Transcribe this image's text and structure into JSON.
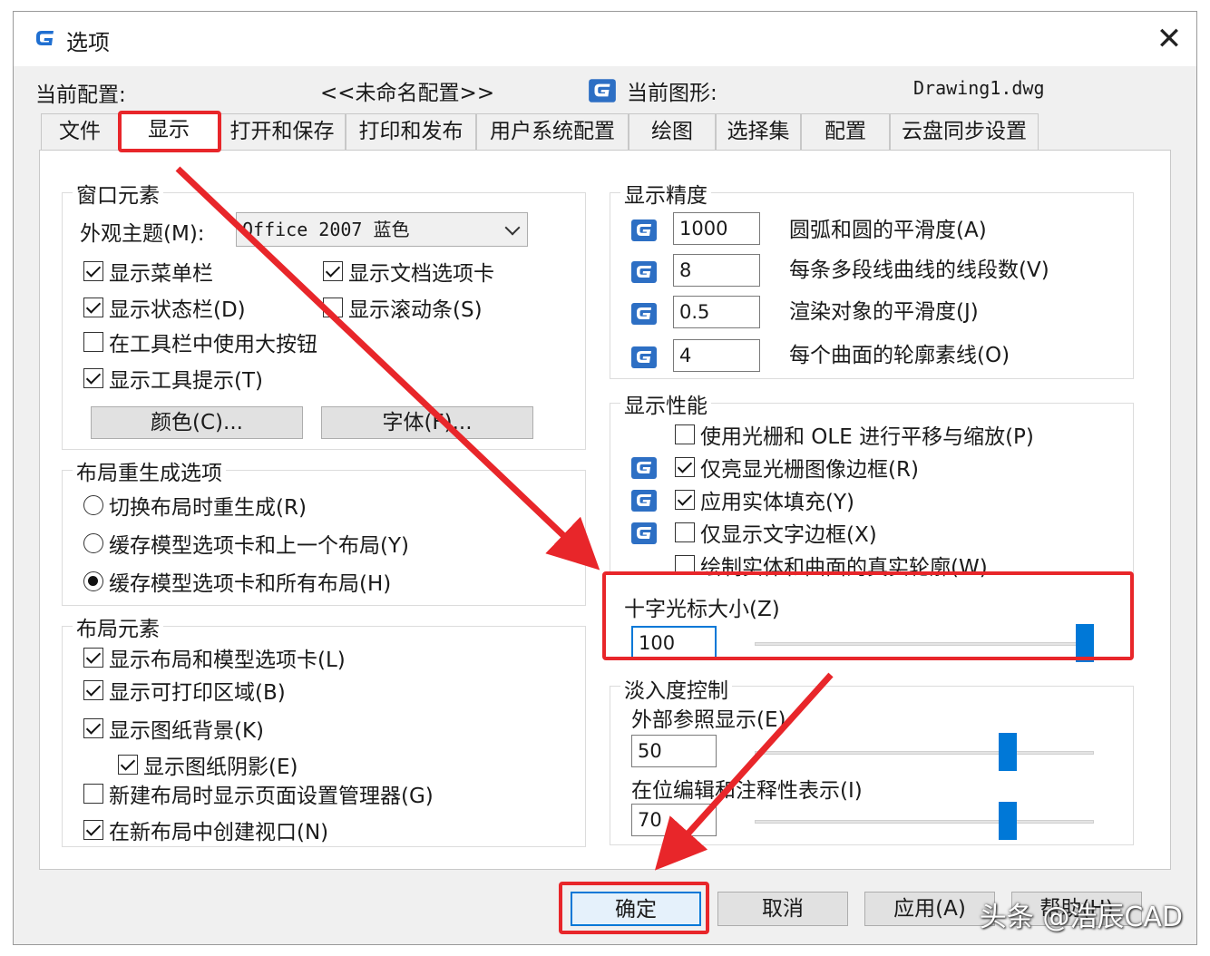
{
  "window": {
    "title": "选项",
    "close_label": "✕"
  },
  "header": {
    "profile_label": "当前配置:",
    "profile_value": "<<未命名配置>>",
    "drawing_label": "当前图形:",
    "drawing_value": "Drawing1.dwg"
  },
  "tabs": [
    "文件",
    "显示",
    "打开和保存",
    "打印和发布",
    "用户系统配置",
    "绘图",
    "选择集",
    "配置",
    "云盘同步设置"
  ],
  "active_tab": "显示",
  "window_elements": {
    "title": "窗口元素",
    "theme_label": "外观主题(M):",
    "theme_value": "Office 2007 蓝色",
    "show_menubar": {
      "label": "显示菜单栏",
      "checked": true
    },
    "show_doc_tabs": {
      "label": "显示文档选项卡",
      "checked": true
    },
    "show_statusbar": {
      "label": "显示状态栏(D)",
      "checked": true
    },
    "show_scrollbars": {
      "label": "显示滚动条(S)",
      "checked": false
    },
    "large_buttons": {
      "label": "在工具栏中使用大按钮",
      "checked": false
    },
    "show_tooltips": {
      "label": "显示工具提示(T)",
      "checked": true
    },
    "colors_button": "颜色(C)...",
    "fonts_button": "字体(F)..."
  },
  "layout_regen": {
    "title": "布局重生成选项",
    "options": [
      "切换布局时重生成(R)",
      "缓存模型选项卡和上一个布局(Y)",
      "缓存模型选项卡和所有布局(H)"
    ],
    "selected_index": 2
  },
  "layout_elements": {
    "title": "布局元素",
    "items": [
      {
        "label": "显示布局和模型选项卡(L)",
        "checked": true
      },
      {
        "label": "显示可打印区域(B)",
        "checked": true
      },
      {
        "label": "显示图纸背景(K)",
        "checked": true
      },
      {
        "label": "显示图纸阴影(E)",
        "checked": true
      },
      {
        "label": "新建布局时显示页面设置管理器(G)",
        "checked": false
      },
      {
        "label": "在新布局中创建视口(N)",
        "checked": true
      }
    ]
  },
  "display_resolution": {
    "title": "显示精度",
    "items": [
      {
        "value": "1000",
        "label": "圆弧和圆的平滑度(A)"
      },
      {
        "value": "8",
        "label": "每条多段线曲线的线段数(V)"
      },
      {
        "value": "0.5",
        "label": "渲染对象的平滑度(J)"
      },
      {
        "value": "4",
        "label": "每个曲面的轮廓素线(O)"
      }
    ]
  },
  "display_performance": {
    "title": "显示性能",
    "items": [
      {
        "label": "使用光栅和 OLE 进行平移与缩放(P)",
        "checked": false
      },
      {
        "label": "仅亮显光栅图像边框(R)",
        "checked": true
      },
      {
        "label": "应用实体填充(Y)",
        "checked": true
      },
      {
        "label": "仅显示文字边框(X)",
        "checked": false
      },
      {
        "label": "绘制实体和曲面的真实轮廓(W)",
        "checked": false
      }
    ]
  },
  "crosshair": {
    "title": "十字光标大小(Z)",
    "value": "100",
    "level_fraction": 1.0
  },
  "fade_control": {
    "title": "淡入度控制",
    "xref_label": "外部参照显示(E)",
    "xref_value": "50",
    "xref_fraction": 0.76,
    "inplace_label": "在位编辑和注释性表示(I)",
    "inplace_value": "70",
    "inplace_fraction": 0.76
  },
  "footer": {
    "ok": "确定",
    "cancel": "取消",
    "apply": "应用(A)",
    "help": "帮助(H)"
  },
  "watermark": "头条 @浩辰CAD",
  "colors": {
    "highlight": "#e8262a",
    "accent": "#0078d7"
  }
}
